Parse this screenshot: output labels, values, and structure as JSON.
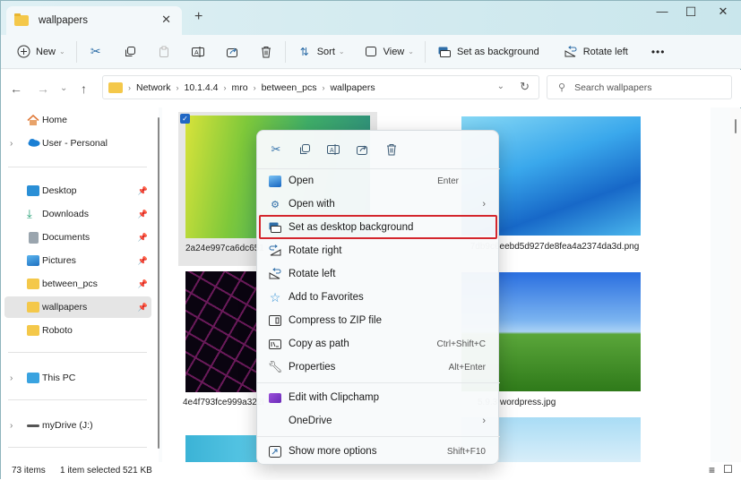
{
  "window": {
    "tab_title": "wallpapers",
    "tab_close": "✕",
    "new_tab": "+",
    "minimize": "—",
    "maximize": "☐",
    "close": "✕"
  },
  "toolbar": {
    "new_label": "New",
    "sort_label": "Sort",
    "view_label": "View",
    "set_bg_label": "Set as background",
    "rotate_left_label": "Rotate left",
    "more": "•••"
  },
  "address": {
    "breadcrumbs": [
      "Network",
      "10.1.4.4",
      "mro",
      "between_pcs",
      "wallpapers"
    ],
    "search_placeholder": "Search wallpapers"
  },
  "sidebar": {
    "items": [
      {
        "label": "Home",
        "icon": "home-icon",
        "expandable": false,
        "pinned": false
      },
      {
        "label": "User - Personal",
        "icon": "onedrive-icon",
        "expandable": true,
        "pinned": false
      },
      {
        "label": "Desktop",
        "icon": "desktop-icon",
        "expandable": false,
        "pinned": true
      },
      {
        "label": "Downloads",
        "icon": "download-icon",
        "expandable": false,
        "pinned": true
      },
      {
        "label": "Documents",
        "icon": "documents-icon",
        "expandable": false,
        "pinned": true
      },
      {
        "label": "Pictures",
        "icon": "pictures-icon",
        "expandable": false,
        "pinned": true
      },
      {
        "label": "between_pcs",
        "icon": "folder-icon",
        "expandable": false,
        "pinned": true
      },
      {
        "label": "wallpapers",
        "icon": "folder-icon",
        "expandable": false,
        "pinned": true,
        "selected": true
      },
      {
        "label": "Roboto",
        "icon": "folder-icon",
        "expandable": false,
        "pinned": false
      },
      {
        "label": "This PC",
        "icon": "pc-icon",
        "expandable": true,
        "pinned": false
      },
      {
        "label": "myDrive (J:)",
        "icon": "drive-icon",
        "expandable": true,
        "pinned": false
      }
    ]
  },
  "files": [
    {
      "name": "2a24e997ca6dc651",
      "selected": true
    },
    {
      "name": "7db9c6eebd5d927de8fea4a2374da3d.png"
    },
    {
      "name": "4e4f793fce999a322l"
    },
    {
      "name": "5.9.3 wordpress.jpg"
    }
  ],
  "context_menu": {
    "quick_actions": [
      "cut-icon",
      "copy-icon",
      "rename-icon",
      "share-icon",
      "delete-icon"
    ],
    "items": [
      {
        "label": "Open",
        "shortcut": "Enter"
      },
      {
        "label": "Open with",
        "submenu": true
      },
      {
        "label": "Set as desktop background",
        "highlighted": true
      },
      {
        "label": "Rotate right"
      },
      {
        "label": "Rotate left"
      },
      {
        "label": "Add to Favorites"
      },
      {
        "label": "Compress to ZIP file"
      },
      {
        "label": "Copy as path",
        "shortcut": "Ctrl+Shift+C"
      },
      {
        "label": "Properties",
        "shortcut": "Alt+Enter"
      },
      {
        "label": "Edit with Clipchamp"
      },
      {
        "label": "OneDrive",
        "submenu": true
      },
      {
        "label": "Show more options",
        "shortcut": "Shift+F10"
      }
    ],
    "highlight_color": "#d4262d"
  },
  "status": {
    "count": "73 items",
    "selection": "1 item selected",
    "size": "521 KB"
  }
}
